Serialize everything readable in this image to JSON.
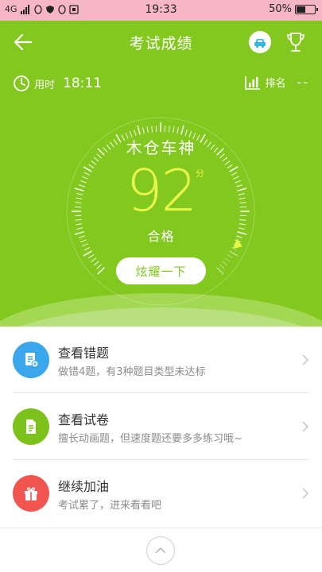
{
  "status_bar": {
    "network": "4G",
    "time": "19:33",
    "battery_text": "50%",
    "battery_level": 0.5
  },
  "header": {
    "title": "考试成绩",
    "time_label": "用时",
    "time_value": "18:11",
    "rank_label": "排名",
    "rank_value": "--"
  },
  "result": {
    "rank_title": "木仓车神",
    "score": "92",
    "score_unit": "分",
    "status": "合格",
    "share_button": "炫耀一下",
    "score_fraction": 0.92
  },
  "menu": [
    {
      "title": "查看错题",
      "subtitle": "做错4题，有3种题目类型未达标",
      "icon": "wrong-questions-icon",
      "color": "#3aa7ec"
    },
    {
      "title": "查看试卷",
      "subtitle": "擅长动画题，但速度题还要多多练习哦~",
      "icon": "exam-paper-icon",
      "color": "#7cc21b"
    },
    {
      "title": "继续加油",
      "subtitle": "考试累了，进来看看吧",
      "icon": "gift-icon",
      "color": "#f0564f"
    }
  ],
  "colors": {
    "primary_green": "#82c81e",
    "score_yellow": "#e7f84a"
  }
}
